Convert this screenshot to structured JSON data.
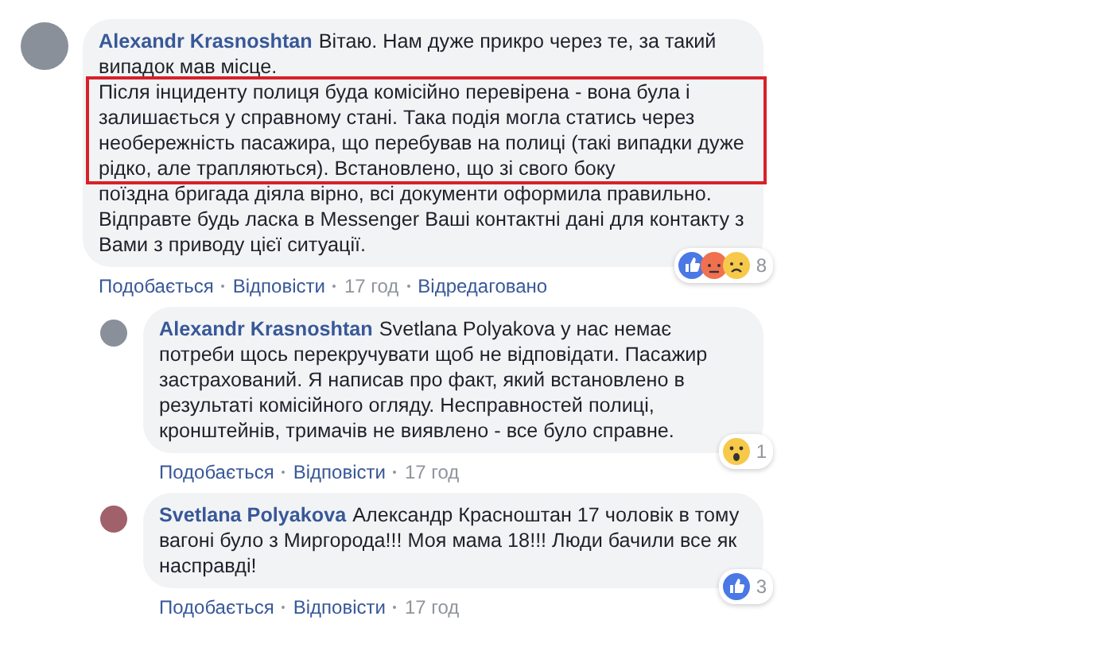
{
  "comments": [
    {
      "author": "Alexandr Krasnoshtan",
      "reply": false,
      "paragraphs": [
        {
          "text": "Вітаю. Нам дуже прикро через те, за такий випадок мав місце.",
          "highlighted": false
        },
        {
          "text": "Після інциденту полиця буда комісійно перевірена - вона була і залишається у справному стані. Така подія могла статись через необережність пасажира, що перебував на полиці (такі випадки дуже рідко, але трапляються). Встановлено, що зі свого боку",
          "highlighted": true
        },
        {
          "text": "поїздна бригада діяла вірно, всі документи оформила правильно. Відправте будь ласка в Messenger Ваші контактні дані для контакту з Вами з приводу цієї ситуації.",
          "highlighted": false
        }
      ],
      "reactions": [
        {
          "kind": "like"
        },
        {
          "kind": "angry"
        },
        {
          "kind": "sad"
        }
      ],
      "reaction_count": "8",
      "actions": [
        {
          "kind": "link",
          "text": "Подобається"
        },
        {
          "kind": "link",
          "text": "Відповісти"
        },
        {
          "kind": "time",
          "text": "17 год"
        },
        {
          "kind": "link",
          "text": "Відредаговано"
        }
      ]
    },
    {
      "author": "Alexandr Krasnoshtan",
      "reply": true,
      "paragraphs": [
        {
          "text": "Svetlana Polyakova у нас немає потреби щось перекручувати щоб не відповідати. Пасажир застрахований. Я написав про факт, який встановлено в результаті комісійного огляду. Несправностей полиці, кронштейнів, тримачів не виявлено - все було справне.",
          "highlighted": false
        }
      ],
      "reactions": [
        {
          "kind": "wow"
        }
      ],
      "reaction_count": "1",
      "actions": [
        {
          "kind": "link",
          "text": "Подобається"
        },
        {
          "kind": "link",
          "text": "Відповісти"
        },
        {
          "kind": "time",
          "text": "17 год"
        }
      ]
    },
    {
      "author": "Svetlana Polyakova",
      "reply": true,
      "paragraphs": [
        {
          "text": "Александр Красноштан 17 чоловік в тому вагоні було з Миргорода!!! Моя мама 18!!! Люди бачили все як насправді!",
          "highlighted": false
        }
      ],
      "reactions": [
        {
          "kind": "like"
        }
      ],
      "reaction_count": "3",
      "actions": [
        {
          "kind": "link",
          "text": "Подобається"
        },
        {
          "kind": "link",
          "text": "Відповісти"
        },
        {
          "kind": "time",
          "text": "17 год"
        }
      ]
    }
  ]
}
